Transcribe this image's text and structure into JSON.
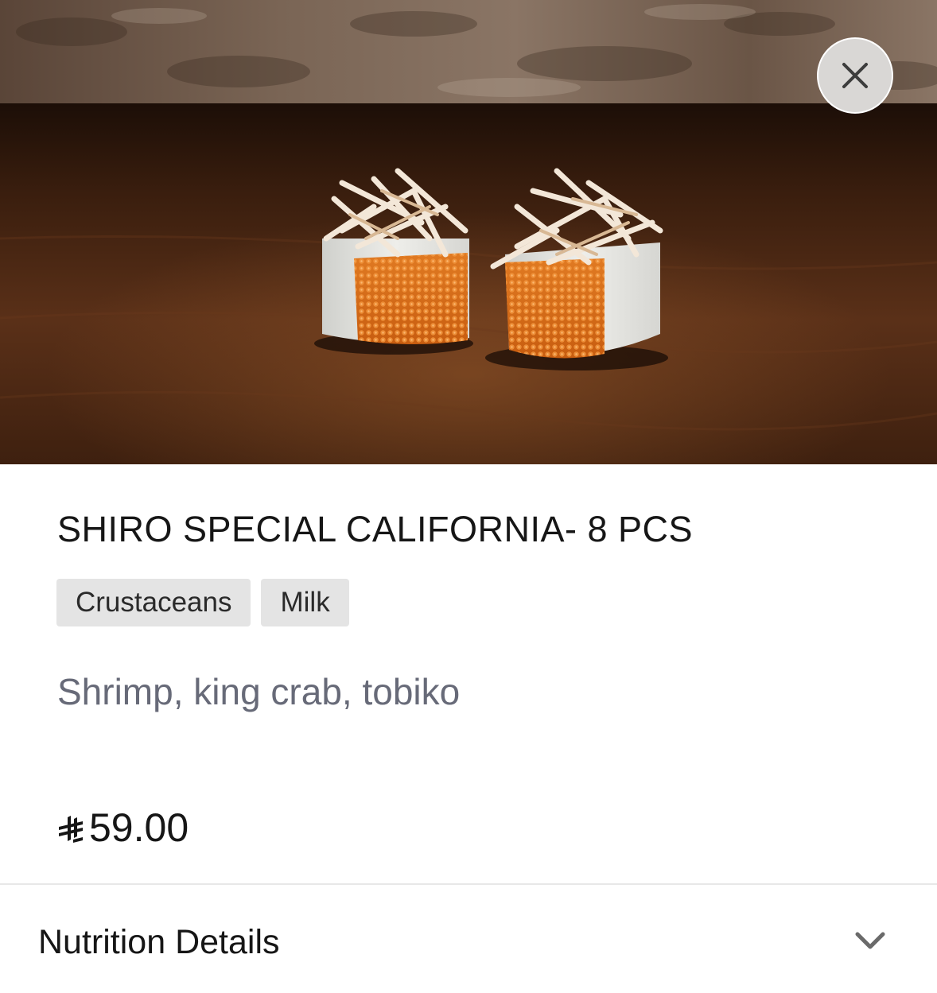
{
  "hero": {
    "image_alt": "Two pieces of sushi rolls topped with shredded crab and orange tobiko on a dark wooden table"
  },
  "close_button": {
    "icon": "close-icon"
  },
  "item": {
    "title": "SHIRO SPECIAL CALIFORNIA- 8 PCS",
    "allergens": [
      "Crustaceans",
      "Milk"
    ],
    "description": "Shrimp, king crab, tobiko",
    "price": "59.00",
    "currency_icon": "saudi-riyal-icon"
  },
  "nutrition": {
    "label": "Nutrition Details",
    "icon": "chevron-down-icon"
  },
  "colors": {
    "title": "#161616",
    "description": "#676a78",
    "tag_bg": "#e4e4e4",
    "divider": "#e8e8e8"
  }
}
